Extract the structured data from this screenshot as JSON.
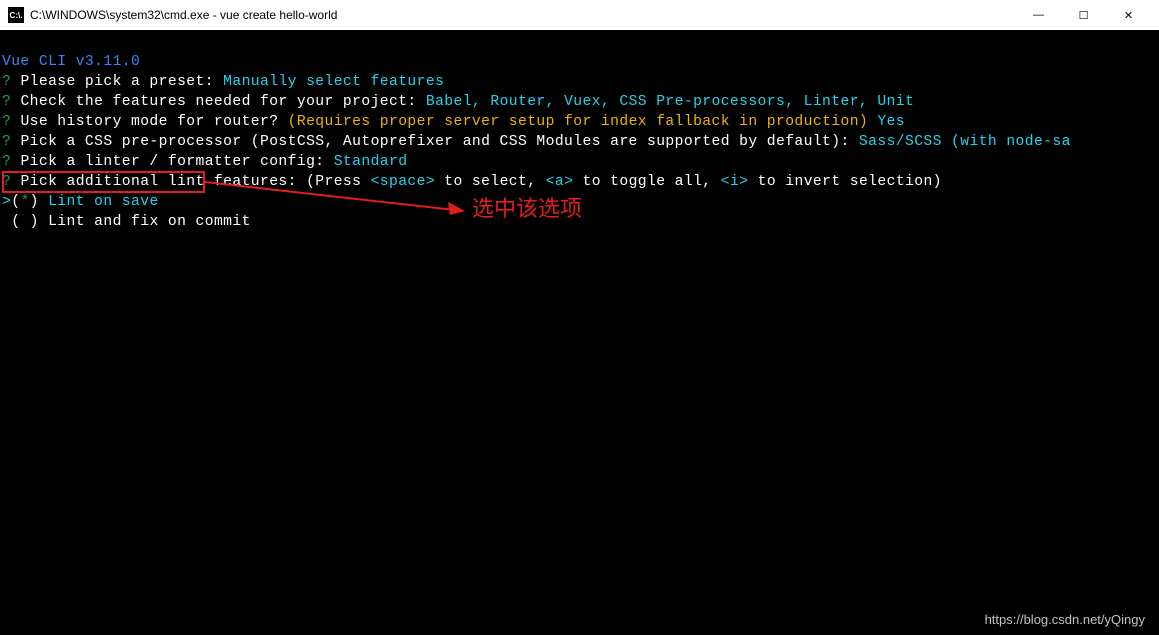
{
  "titlebar": {
    "icon_label": "C:\\.",
    "title": "C:\\WINDOWS\\system32\\cmd.exe - vue  create hello-world"
  },
  "window_controls": {
    "minimize": "—",
    "maximize": "☐",
    "close": "✕"
  },
  "cli": {
    "version": "Vue CLI v3.11.0"
  },
  "prompts": {
    "preset": {
      "question": "Please pick a preset:",
      "answer": "Manually select features"
    },
    "features": {
      "question": "Check the features needed for your project:",
      "answer": "Babel, Router, Vuex, CSS Pre-processors, Linter, Unit"
    },
    "history": {
      "question": "Use history mode for router?",
      "note": "(Requires proper server setup for index fallback in production)",
      "answer": "Yes"
    },
    "css_preprocessor": {
      "question": "Pick a CSS pre-processor (PostCSS, Autoprefixer and CSS Modules are supported by default):",
      "answer": "Sass/SCSS (with node-sa"
    },
    "linter": {
      "question": "Pick a linter / formatter config:",
      "answer": "Standard"
    },
    "lint_features": {
      "question": "Pick additional lint features: (Press ",
      "space_key": "<space>",
      "mid1": " to select, ",
      "a_key": "<a>",
      "mid2": " to toggle all, ",
      "i_key": "<i>",
      "mid3": " to invert selection)"
    }
  },
  "options": {
    "lint_on_save": {
      "marker": "*",
      "label": "Lint on save"
    },
    "lint_on_commit": {
      "marker": " ",
      "label": "Lint and fix on commit"
    }
  },
  "annotation": {
    "text": "选中该选项"
  },
  "watermark": {
    "text": "https://blog.csdn.net/yQingy"
  }
}
